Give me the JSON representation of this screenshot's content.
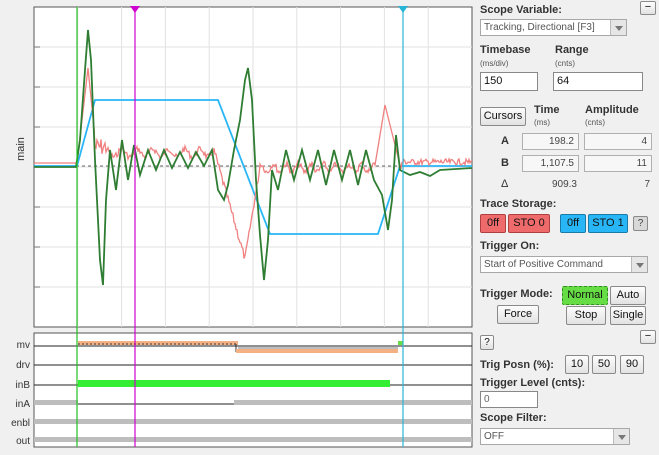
{
  "scope": {
    "side_label": "main",
    "digital_labels": [
      "mv",
      "drv",
      "inB",
      "inA",
      "enbl",
      "out"
    ]
  },
  "panel": {
    "scope_variable_title": "Scope Variable:",
    "scope_variable_value": "Tracking, Directional [F3]",
    "collapse_symbol": "−",
    "timebase_title": "Timebase",
    "timebase_unit": "(ms/div)",
    "timebase_value": "150",
    "range_title": "Range",
    "range_unit": "(cnts)",
    "range_value": "64",
    "cursors_button": "Cursors",
    "time_title": "Time",
    "time_unit": "(ms)",
    "amplitude_title": "Amplitude",
    "amplitude_unit": "(cnts)",
    "row_a_label": "A",
    "row_a_time": "198.2",
    "row_a_amp": "4",
    "row_b_label": "B",
    "row_b_time": "1,107.5",
    "row_b_amp": "11",
    "row_delta_label": "Δ",
    "row_delta_time": "909.3",
    "row_delta_amp": "7",
    "trace_storage_title": "Trace Storage:",
    "off1": "0ff",
    "sto0": "STO 0",
    "off2": "0ff",
    "sto1": "STO 1",
    "help_symbol": "?",
    "trigger_on_title": "Trigger On:",
    "trigger_on_value": "Start of Positive Command",
    "trigger_mode_title": "Trigger Mode:",
    "normal": "Normal",
    "auto": "Auto",
    "force": "Force",
    "stop": "Stop",
    "single": "Single",
    "trig_posn_title": "Trig Posn (%):",
    "trig_posn_10": "10",
    "trig_posn_50": "50",
    "trig_posn_90": "90",
    "trigger_level_title": "Trigger Level (cnts):",
    "trigger_level_value": "0",
    "scope_filter_title": "Scope Filter:",
    "scope_filter_value": "OFF"
  },
  "colors": {
    "green_trace": "#2e7d32",
    "pink_trace": "#f08080",
    "blue_trace": "#29b6f6",
    "cursor_green": "#22c022",
    "cursor_magenta": "#d000d0",
    "cursor_cyan": "#29b6d6",
    "off_red": "#ef6b6b",
    "sto_blue": "#29b6f6",
    "normal_green": "#66dd44"
  }
}
